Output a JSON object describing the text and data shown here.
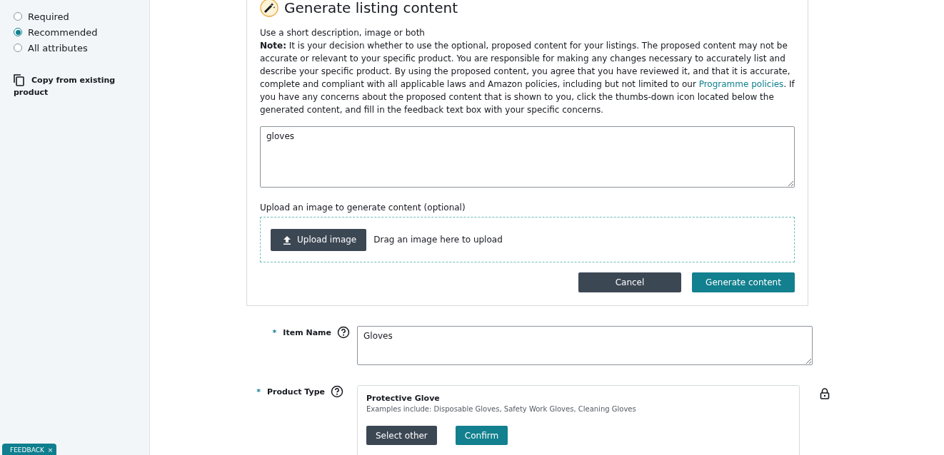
{
  "sidebar": {
    "attribute_options": [
      {
        "label": "Required",
        "selected": false
      },
      {
        "label": "Recommended",
        "selected": true
      },
      {
        "label": "All attributes",
        "selected": false
      }
    ],
    "copy_link": "Copy from existing product"
  },
  "generate_panel": {
    "title": "Generate listing content",
    "subtitle": "Use a short description, image or both",
    "note": "**Note:** It is your decision whether to use the optional, proposed content for your listings. The proposed content may not be accurate or relevant to your specific product. You are responsible for making any changes necessary to accurately list and describe your specific product. By using the proposed content, you agree that you have reviewed it, and that it is accurate, complete and compliant with all applicable laws and Amazon policies, including but not limited to our ",
    "note_link": "Programme policies",
    "note_end": ". If you have any concerns about the proposed content that is shown to you, click the thumbs-down icon located below the generated content, and fill in the feedback text box with your specific concerns.",
    "description": "gloves",
    "upload_label": "Upload an image to generate content (optional)",
    "upload_button": "Upload image",
    "drop_hint": "Drag an image here to upload",
    "buttons": [
      "Cancel",
      "Generate content"
    ]
  },
  "item_name": {
    "label": "Item Name",
    "required_mark": "*",
    "value": "Gloves"
  },
  "product_type": {
    "label": "Product Type",
    "required_mark": "*",
    "name": "Protective Glove",
    "examples": "Examples include: Disposable Gloves, Safety Work Gloves, Cleaning Gloves",
    "buttons": [
      "Select other",
      "Confirm"
    ]
  },
  "feedback_tab": {
    "label": "FEEDBACK",
    "close": "×"
  }
}
